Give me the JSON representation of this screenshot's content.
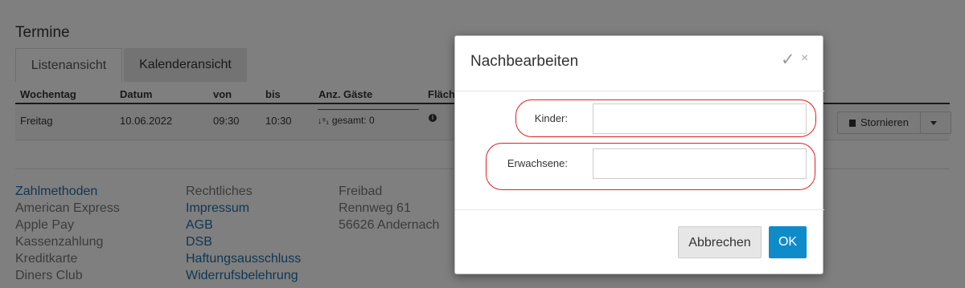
{
  "page": {
    "title": "Termine",
    "tabs": [
      {
        "label": "Listenansicht"
      },
      {
        "label": "Kalenderansicht"
      }
    ],
    "table": {
      "headers": [
        "Wochentag",
        "Datum",
        "von",
        "bis",
        "Anz. Gäste",
        "Fläch"
      ],
      "row": {
        "wochentag": "Freitag",
        "datum": "10.06.2022",
        "von": "09:30",
        "bis": "10:30",
        "gaeste": "gesamt: 0"
      },
      "cancel_button": "Stornieren"
    }
  },
  "footer": {
    "col1": [
      "Zahlmethoden",
      "American Express",
      "Apple Pay",
      "Kassenzahlung",
      "Kreditkarte",
      "Diners Club"
    ],
    "col2": [
      "Rechtliches",
      "Impressum",
      "AGB",
      "DSB",
      "Haftungsausschluss",
      "Widerrufsbelehrung"
    ],
    "col3": [
      "Freibad",
      "Rennweg 61",
      "56626 Andernach"
    ]
  },
  "modal": {
    "title": "Nachbearbeiten",
    "fields": {
      "kinder_label": "Kinder:",
      "kinder_value": "",
      "erwachsene_label": "Erwachsene:",
      "erwachsene_value": ""
    },
    "cancel_label": "Abbrechen",
    "ok_label": "OK"
  },
  "colors": {
    "link": "#1f6fa4",
    "primary_button": "#0e8bc8",
    "highlight_ring": "#e02020"
  }
}
